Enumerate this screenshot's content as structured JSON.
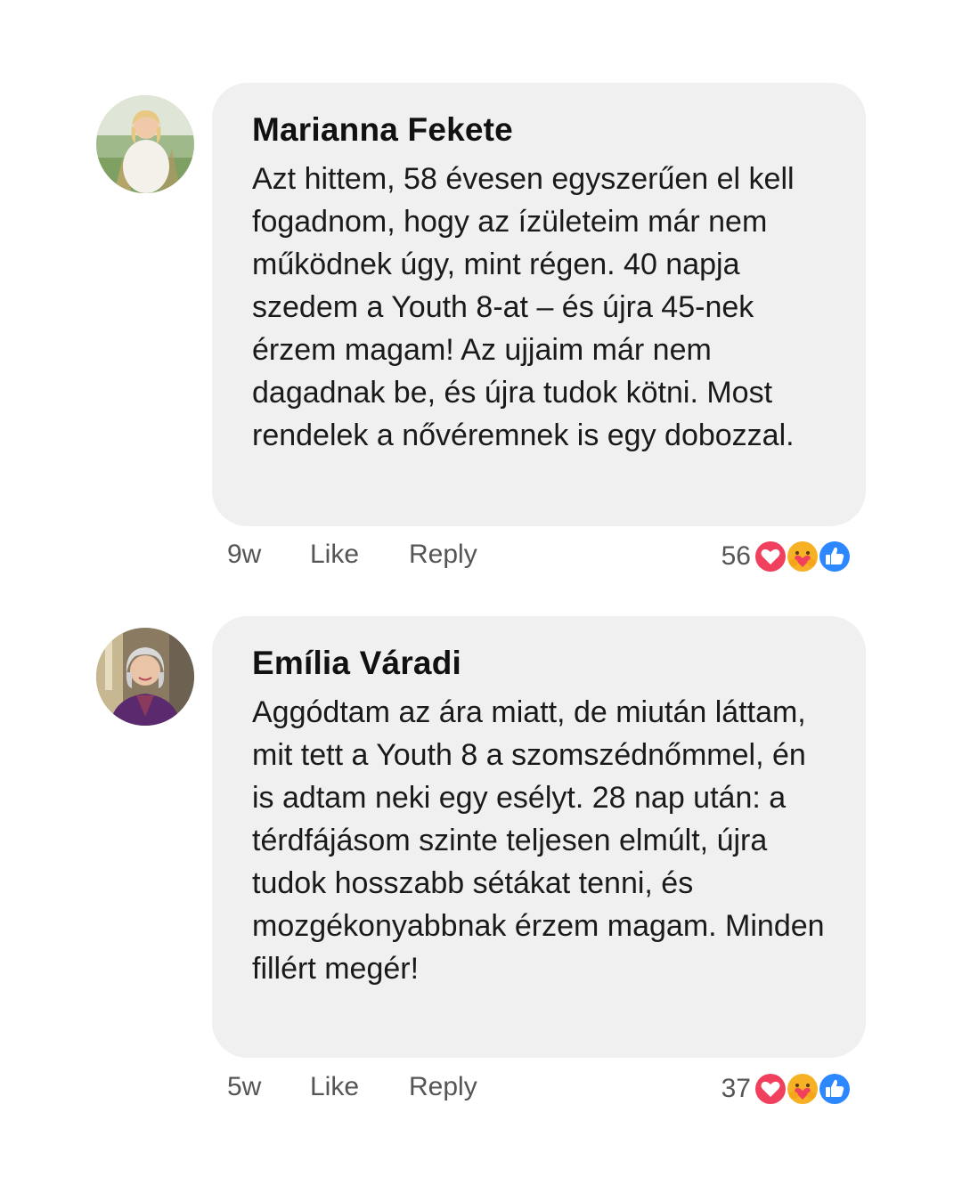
{
  "comments": [
    {
      "author": "Marianna Fekete",
      "avatar_icon": "avatar-woman-blonde-outdoors",
      "text": "Azt hittem, 58 évesen egyszerűen el kell fogadnom, hogy az ízületeim már nem működnek úgy, mint régen. 40 napja szedem a Youth 8-at – és újra 45-nek érzem magam! Az ujjaim már nem dagadnak be, és újra tudok kötni. Most rendelek a nővéremnek is egy dobozzal.",
      "time": "9w",
      "like_label": "Like",
      "reply_label": "Reply",
      "reaction_count": "56",
      "reactions": [
        "love-icon",
        "care-icon",
        "like-icon"
      ]
    },
    {
      "author": "Emília Váradi",
      "avatar_icon": "avatar-woman-gray-hair",
      "text": "Aggódtam az ára miatt, de miután láttam, mit tett a Youth 8 a szomszédnőmmel, én is adtam neki egy esélyt. 28 nap után: a térdfájásom szinte teljesen elmúlt, újra tudok hosszabb sétákat tenni, és mozgékonyabbnak érzem magam. Minden fillért megér!",
      "time": "5w",
      "like_label": "Like",
      "reply_label": "Reply",
      "reaction_count": "37",
      "reactions": [
        "love-icon",
        "care-icon",
        "like-icon"
      ]
    }
  ],
  "colors": {
    "bubble": "#f0f0f0",
    "love": "#f0405e",
    "care": "#f7b125",
    "like": "#2d88ff"
  }
}
